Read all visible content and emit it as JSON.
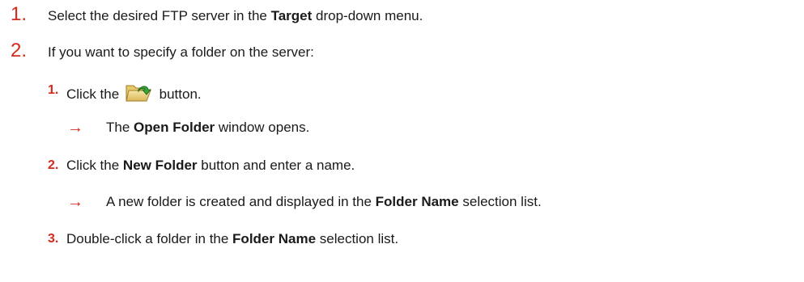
{
  "steps": [
    {
      "number": "1.",
      "text_before": "Select the desired FTP server in the ",
      "bold": "Target",
      "text_after": " drop-down menu."
    },
    {
      "number": "2.",
      "text": "If you want to specify a folder on the server:"
    }
  ],
  "substeps": [
    {
      "number": "1.",
      "text_before": "Click the ",
      "icon": "folder-open-arrow-icon",
      "text_after": " button.",
      "result": {
        "arrow": "→",
        "text_before": "The ",
        "bold": "Open Folder",
        "text_after": " window opens."
      }
    },
    {
      "number": "2.",
      "text_before": "Click the ",
      "bold": "New Folder",
      "text_after": " button and enter a name.",
      "result": {
        "arrow": "→",
        "text_before": "A new folder is created and displayed in the ",
        "bold": "Folder Name",
        "text_after": " selection list."
      }
    },
    {
      "number": "3.",
      "text_before": "Double-click a folder in the ",
      "bold": "Folder Name",
      "text_after": " selection list."
    }
  ],
  "colors": {
    "accent": "#d42a1e",
    "text": "#1a1a1a"
  }
}
